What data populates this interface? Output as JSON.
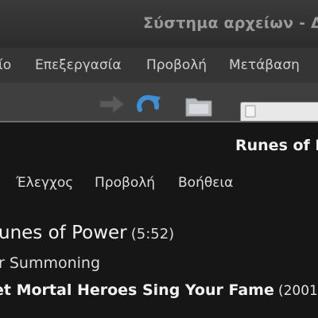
{
  "file_manager": {
    "title": "Σύστημα αρχείων - Δ",
    "menu": [
      "ίο",
      "Επεξεργασία",
      "Προβολή",
      "Μετάβαση"
    ],
    "toolbar_icons": [
      "forward-arrow-icon",
      "reload-icon",
      "folder-icon"
    ],
    "location_icon": "drive-icon"
  },
  "player": {
    "title": "Runes of P",
    "menu": [
      "Έλεγχος",
      "Προβολή",
      "Βοήθεια"
    ],
    "track": {
      "name": "unes of Power",
      "duration": "(5:52)"
    },
    "artist": "r Summoning",
    "album": {
      "name": "et Mortal Heroes Sing Your Fame",
      "year": "(2001)"
    }
  },
  "colors": {
    "fm_background": "#3c3c3c",
    "player_background": "#161616",
    "reload_blue": "#3d8fd6",
    "folder_gray": "#b9bcc0"
  }
}
